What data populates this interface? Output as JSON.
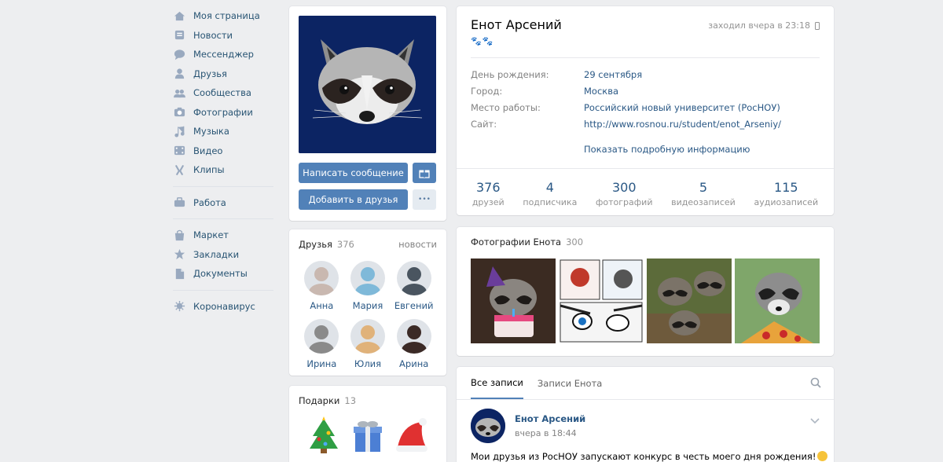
{
  "nav": {
    "items": [
      {
        "label": "Моя страница",
        "icon": "home-icon"
      },
      {
        "label": "Новости",
        "icon": "news-icon"
      },
      {
        "label": "Мессенджер",
        "icon": "messenger-icon"
      },
      {
        "label": "Друзья",
        "icon": "friends-icon"
      },
      {
        "label": "Сообщества",
        "icon": "communities-icon"
      },
      {
        "label": "Фотографии",
        "icon": "camera-icon"
      },
      {
        "label": "Музыка",
        "icon": "music-icon"
      },
      {
        "label": "Видео",
        "icon": "video-icon"
      },
      {
        "label": "Клипы",
        "icon": "clips-icon"
      }
    ],
    "work": {
      "label": "Работа",
      "icon": "briefcase-icon"
    },
    "items2": [
      {
        "label": "Маркет",
        "icon": "market-icon"
      },
      {
        "label": "Закладки",
        "icon": "star-icon"
      },
      {
        "label": "Документы",
        "icon": "document-icon"
      }
    ],
    "covid": {
      "label": "Коронавирус",
      "icon": "virus-icon"
    }
  },
  "profile": {
    "name": "Енот Арсений",
    "status_emoji": "🐾🐾",
    "online": "заходил вчера в 23:18",
    "info": [
      {
        "key": "День рождения:",
        "value": "29 сентября"
      },
      {
        "key": "Город:",
        "value": "Москва"
      },
      {
        "key": "Место работы:",
        "value": "Российский новый университет (РосНОУ)"
      },
      {
        "key": "Сайт:",
        "value": "http://www.rosnou.ru/student/enot_Arseniy/"
      }
    ],
    "show_more": "Показать подробную информацию",
    "counters": [
      {
        "n": "376",
        "l": "друзей"
      },
      {
        "n": "4",
        "l": "подписчика"
      },
      {
        "n": "300",
        "l": "фотографий"
      },
      {
        "n": "5",
        "l": "видеозаписей"
      },
      {
        "n": "115",
        "l": "аудиозаписей"
      }
    ]
  },
  "actions": {
    "message": "Написать сообщение",
    "add_friend": "Добавить в друзья",
    "more": "•••"
  },
  "friends": {
    "title": "Друзья",
    "count": "376",
    "link": "новости",
    "list": [
      {
        "name": "Анна",
        "color": "#c9b8b0"
      },
      {
        "name": "Мария",
        "color": "#7fb9d9"
      },
      {
        "name": "Евгений",
        "color": "#4a5560"
      },
      {
        "name": "Ирина",
        "color": "#8a8a8a"
      },
      {
        "name": "Юлия",
        "color": "#e0b27a"
      },
      {
        "name": "Арина",
        "color": "#3b2a26"
      }
    ]
  },
  "gifts": {
    "title": "Подарки",
    "count": "13"
  },
  "photos": {
    "title": "Фотографии Енота",
    "count": "300"
  },
  "wall": {
    "tabs": [
      "Все записи",
      "Записи Енота"
    ],
    "post": {
      "author": "Енот Арсений",
      "time": "вчера в 18:44",
      "text": "Мои друзья из РосНОУ запускают конкурс в честь моего дня рождения!"
    }
  }
}
